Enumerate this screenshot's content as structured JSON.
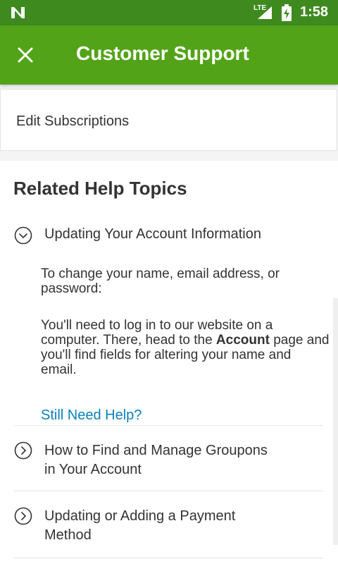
{
  "status_bar": {
    "network": "LTE",
    "time": "1:58"
  },
  "app_bar": {
    "title": "Customer Support",
    "close_icon": "close-icon"
  },
  "subscriptions": {
    "label": "Edit Subscriptions"
  },
  "help": {
    "title": "Related Help Topics",
    "topics": [
      {
        "label": "Updating Your Account Information",
        "expanded": true,
        "body_intro": "To change your name, email address, or password:",
        "body_pre": "You'll need to log in to our website on a computer. There, head to the ",
        "body_bold": "Account",
        "body_post": " page and you'll find fields for altering your name and email.",
        "help_link": "Still Need Help?"
      },
      {
        "label_line1": "How to Find and Manage Groupons",
        "label_line2": "in Your Account",
        "expanded": false
      },
      {
        "label_line1": "Updating or Adding a Payment",
        "label_line2": "Method",
        "expanded": false
      }
    ]
  },
  "colors": {
    "status_bar": "#3f8a1f",
    "app_bar": "#53a318",
    "link": "#0a7fbc",
    "text": "#333333"
  }
}
